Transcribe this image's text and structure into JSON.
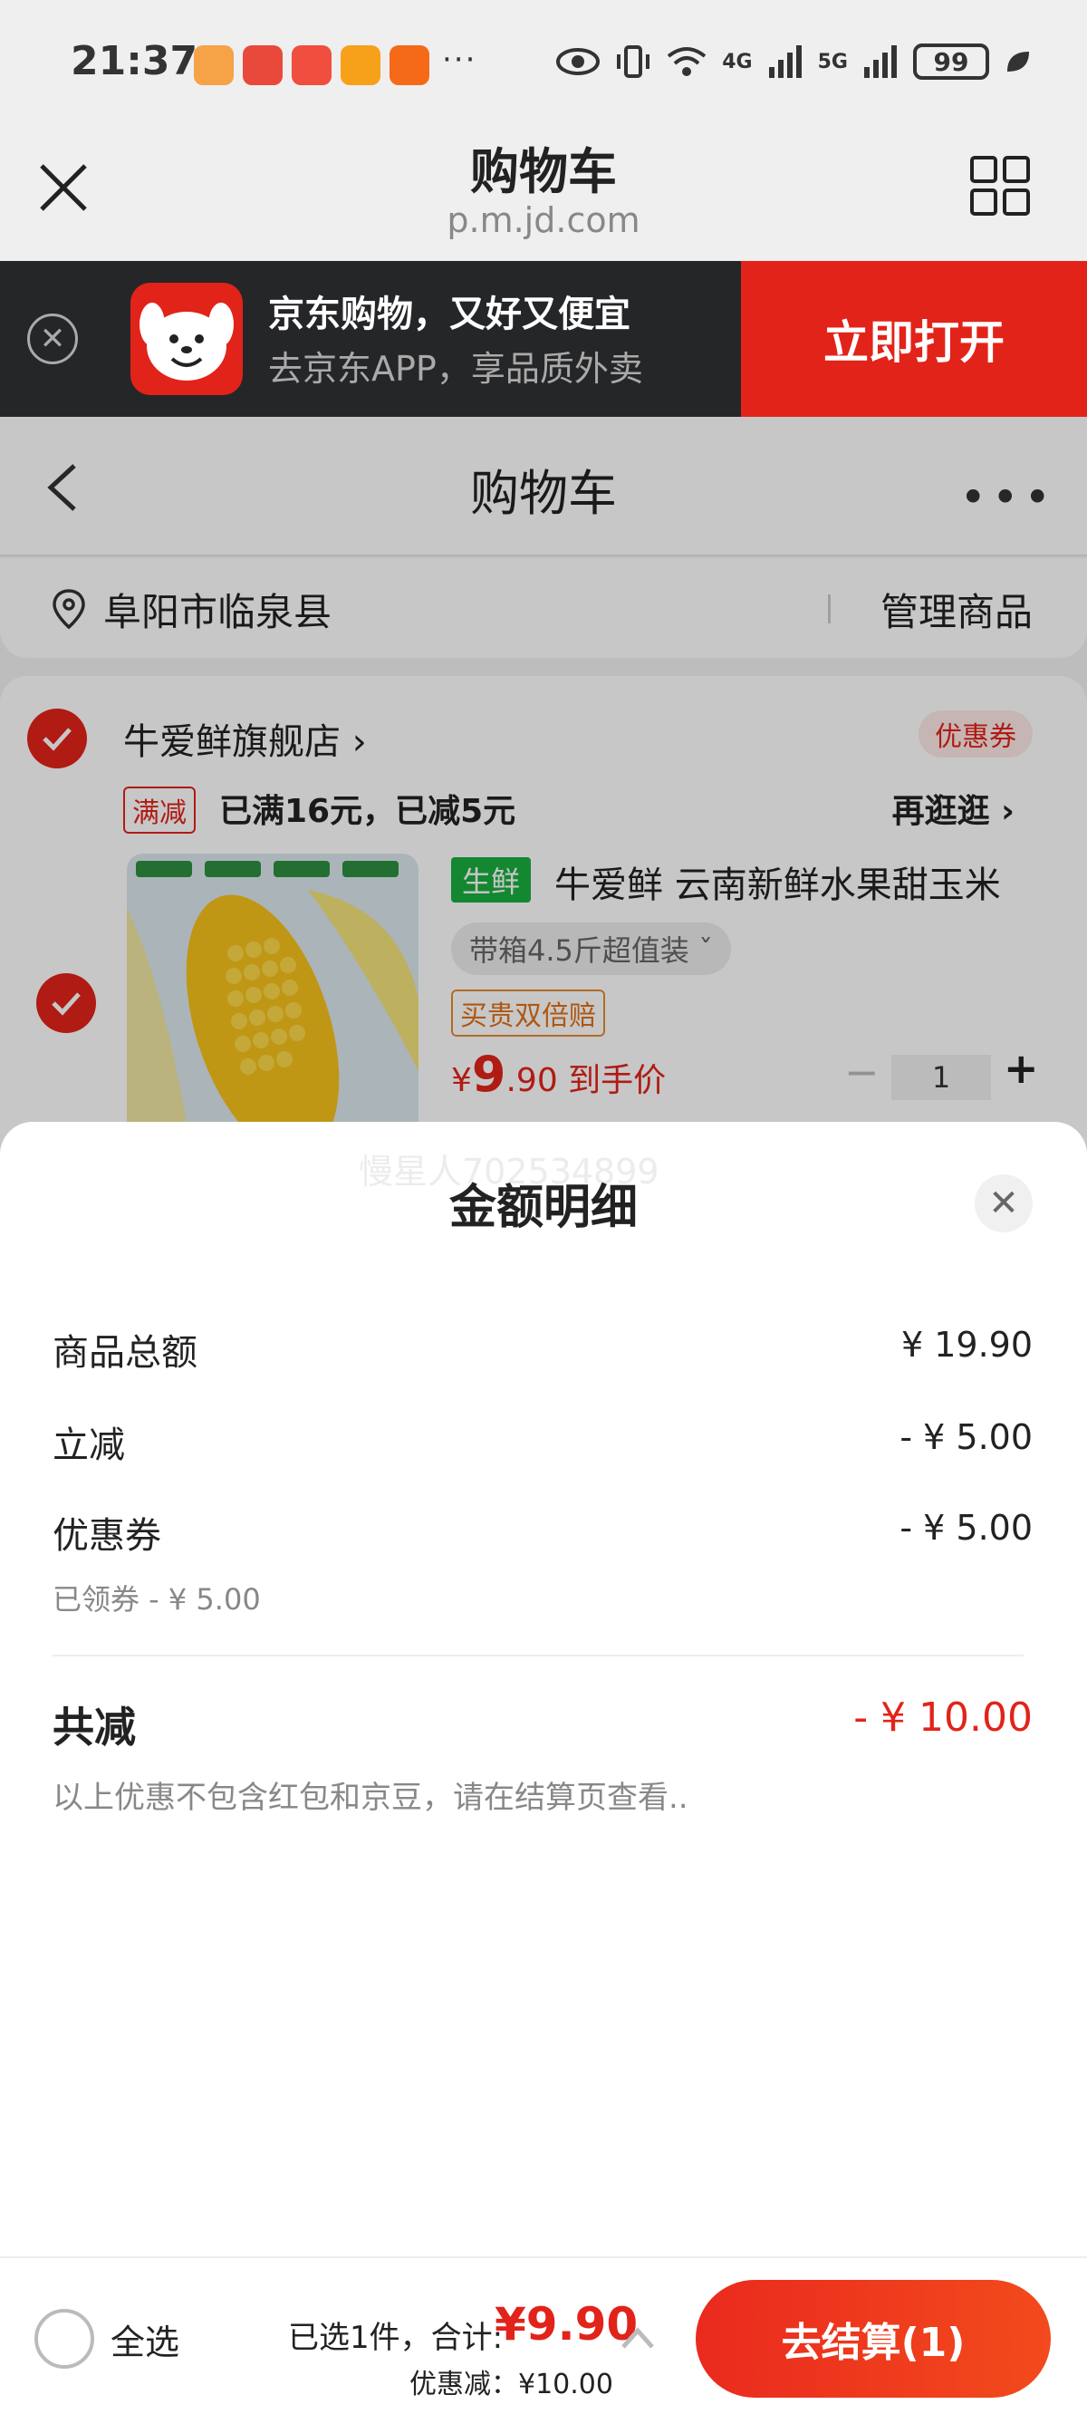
{
  "status_bar": {
    "time": "21:37",
    "dots": "···",
    "network_4g": "4G",
    "network_5g": "5G",
    "battery": "99"
  },
  "browser": {
    "title": "购物车",
    "url": "p.m.jd.com"
  },
  "app_banner": {
    "title": "京东购物，又好又便宜",
    "subtitle": "去京东APP，享品质外卖",
    "open_button": "立即打开",
    "brand_color": "#e2231a"
  },
  "cart_page": {
    "nav_title": "购物车",
    "more": "•••",
    "location": "阜阳市临泉县",
    "manage": "管理商品",
    "store": {
      "name": "牛爱鲜旗舰店 ›",
      "coupon_tag": "优惠券",
      "promo_tag": "满减",
      "promo_text": "已满16元，已减5元",
      "browse_more": "再逛逛 ›"
    },
    "product": {
      "fresh_tag": "生鲜",
      "title": "牛爱鲜 云南新鲜水果甜玉米",
      "spec": "带箱4.5斤超值装 ˇ",
      "guarantee_tag": "买贵双倍赔",
      "price_symbol": "¥",
      "price_main": "9",
      "price_rest": ".90 到手价",
      "qty_minus": "−",
      "quantity": "1",
      "qty_plus": "+"
    }
  },
  "detail_sheet": {
    "watermark": "慢星人702534899",
    "title": "金额明细",
    "rows": [
      {
        "label": "商品总额",
        "value": "¥ 19.90"
      },
      {
        "label": "立减",
        "value": "- ¥ 5.00"
      },
      {
        "label": "优惠券",
        "value": "- ¥ 5.00",
        "sub": "已领券 - ¥ 5.00"
      }
    ],
    "total_label": "共减",
    "total_value": "- ¥ 10.00",
    "note": "以上优惠不包含红包和京豆，请在结算页查看.."
  },
  "bottom_bar": {
    "select_all": "全选",
    "summary": "已选1件，合计:",
    "amount": "¥9.90",
    "discount": "优惠减：¥10.00",
    "checkout": "去结算(1)"
  }
}
